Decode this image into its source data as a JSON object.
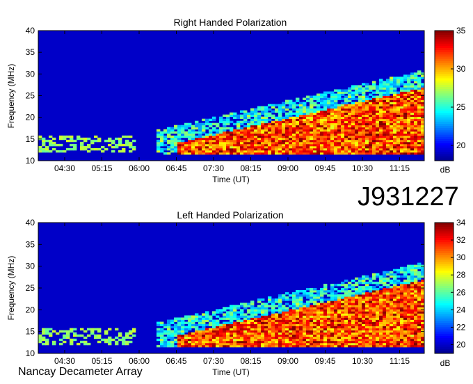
{
  "observation_id": "J931227",
  "instrument": "Nancay Decameter Array",
  "colors": {
    "colormap": [
      "#00008f",
      "#0000ff",
      "#007fff",
      "#00ffff",
      "#7fff7f",
      "#ffff00",
      "#ff7f00",
      "#ff0000",
      "#7f0000"
    ]
  },
  "chart_data": [
    {
      "type": "heatmap",
      "title": "Right Handed Polarization",
      "xlabel": "Time (UT)",
      "ylabel": "Frequency (MHz)",
      "x_ticks": [
        "04:30",
        "05:15",
        "06:00",
        "06:45",
        "07:30",
        "08:15",
        "09:00",
        "09:45",
        "10:30",
        "11:15"
      ],
      "y_ticks": [
        10,
        15,
        20,
        25,
        30,
        35,
        40
      ],
      "ylim": [
        10,
        40
      ],
      "colorbar": {
        "label": "dB",
        "range": [
          18,
          35
        ],
        "ticks": [
          20,
          25,
          30,
          35
        ]
      }
    },
    {
      "type": "heatmap",
      "title": "Left Handed Polarization",
      "xlabel": "Time (UT)",
      "ylabel": "Frequency (MHz)",
      "x_ticks": [
        "04:30",
        "05:15",
        "06:00",
        "06:45",
        "07:30",
        "08:15",
        "09:00",
        "09:45",
        "10:30",
        "11:15"
      ],
      "y_ticks": [
        10,
        15,
        20,
        25,
        30,
        35,
        40
      ],
      "ylim": [
        10,
        40
      ],
      "colorbar": {
        "label": "dB",
        "range": [
          19,
          34
        ],
        "ticks": [
          20,
          22,
          24,
          26,
          28,
          30,
          32,
          34
        ]
      }
    }
  ]
}
